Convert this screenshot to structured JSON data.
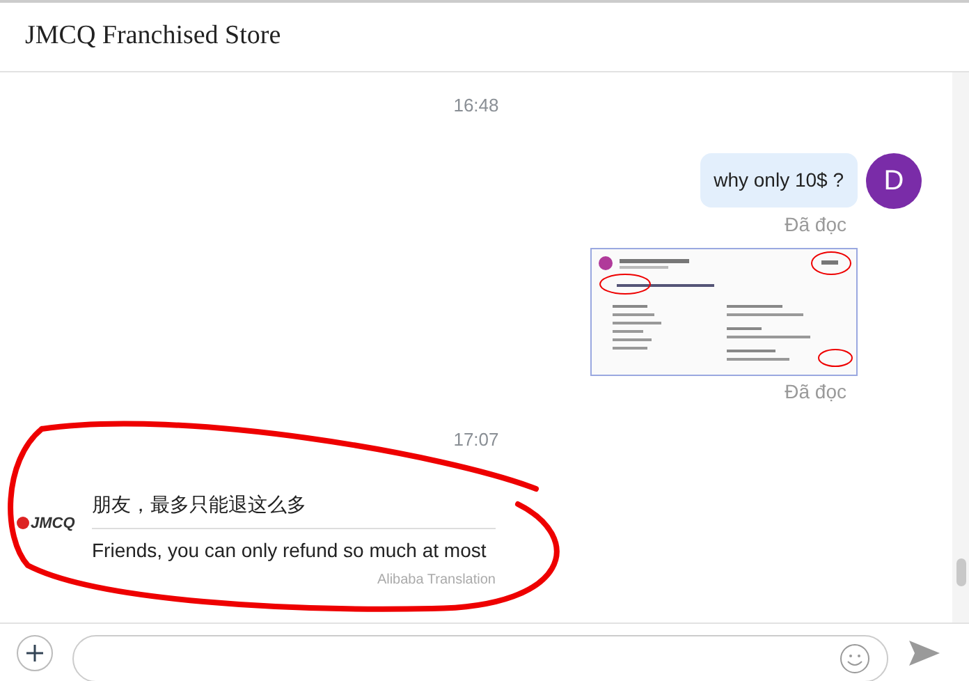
{
  "header": {
    "title": "JMCQ Franchised Store"
  },
  "messages": [
    {
      "kind": "time",
      "text": "16:48"
    },
    {
      "kind": "outgoing",
      "text": "why only 10$ ?",
      "avatar": "D",
      "status": "Đã đọc"
    },
    {
      "kind": "image",
      "status": "Đã đọc"
    },
    {
      "kind": "time",
      "text": "17:07"
    },
    {
      "kind": "incoming",
      "sender_logo": "JMCQ",
      "original": "朋友，最多只能退这么多",
      "translation": "Friends, you can only refund so much at most",
      "translation_source": "Alibaba Translation"
    }
  ]
}
